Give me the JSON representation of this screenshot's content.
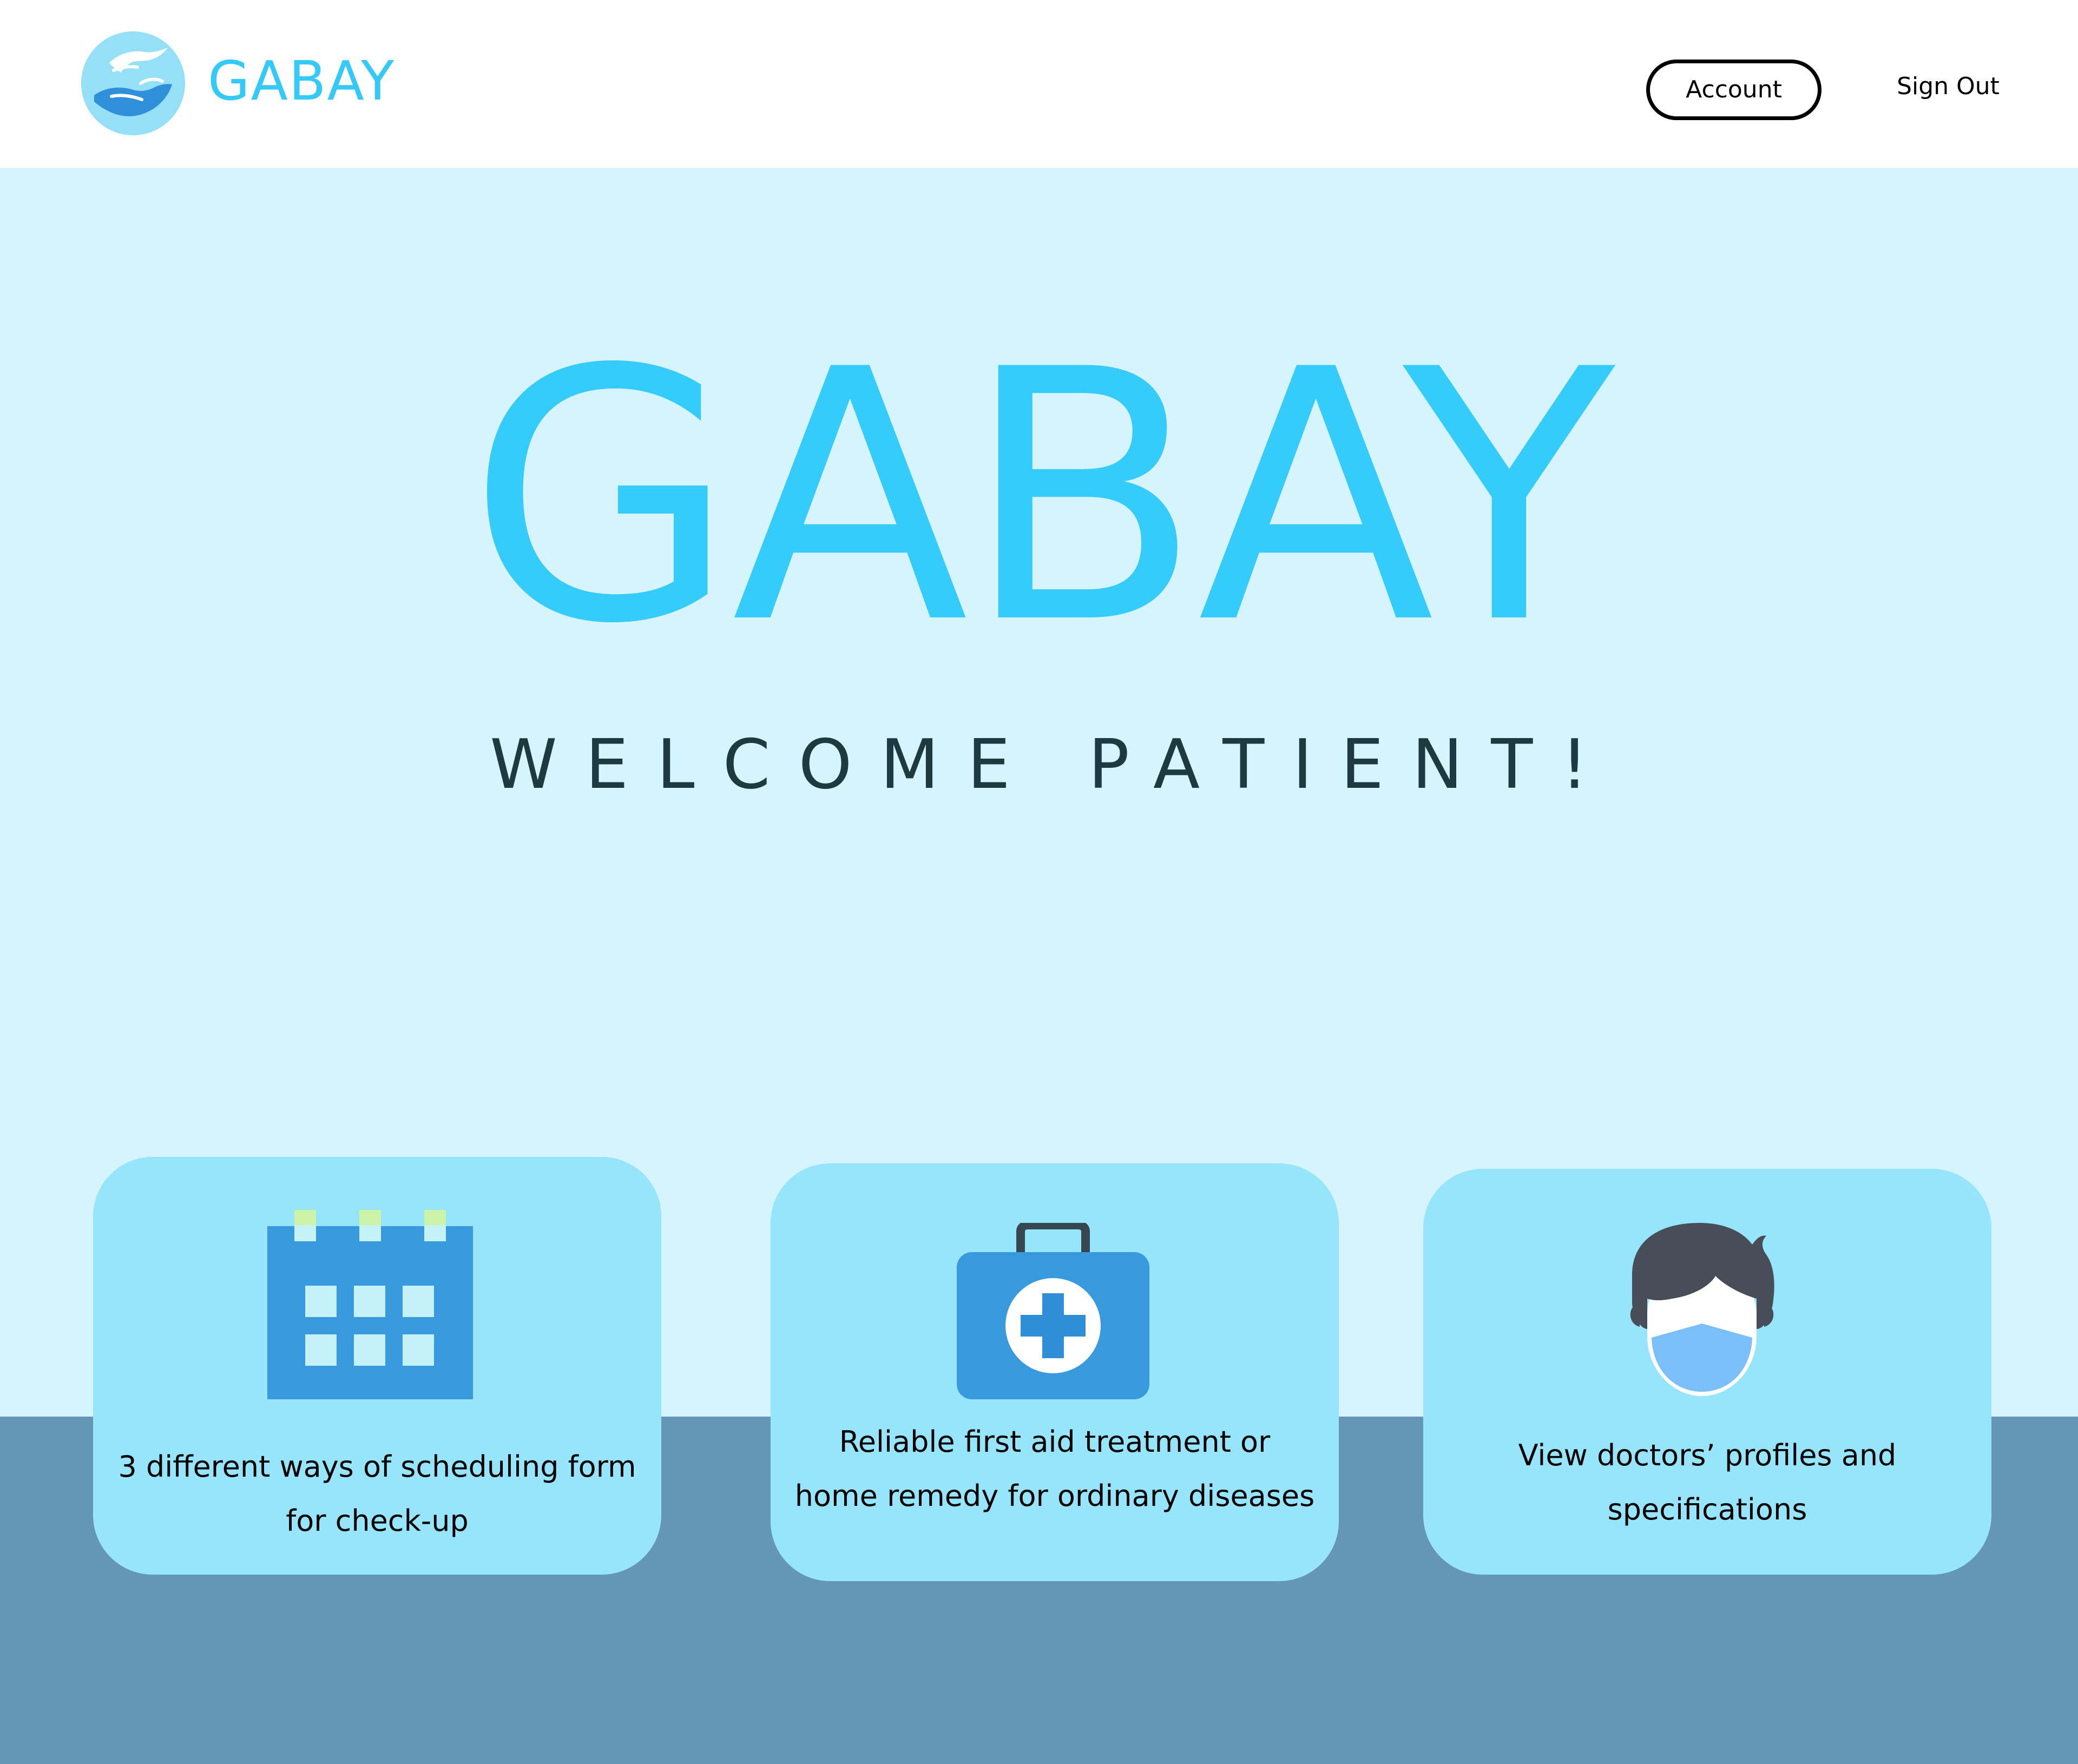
{
  "app": {
    "brand_name": "GABAY",
    "logo_icon": "hands-care-icon",
    "brand_color": "#35cbfa"
  },
  "header": {
    "account_label": "Account",
    "signout_label": "Sign Out"
  },
  "hero": {
    "title": "GABAY",
    "subtitle": "WELCOME PATIENT!"
  },
  "features": [
    {
      "icon": "calendar-icon",
      "line1": "3 different ways of scheduling form",
      "line2": "for check-up"
    },
    {
      "icon": "first-aid-kit-icon",
      "line1": "Reliable first aid treatment or",
      "line2": "home remedy for ordinary diseases"
    },
    {
      "icon": "masked-doctor-icon",
      "line1": "View doctors’ profiles and",
      "line2": "specifications"
    }
  ],
  "colors": {
    "page_background": "#d6f4fd",
    "card_background": "#96e5fc",
    "bottom_band": "#6596b8",
    "icon_blue": "#3899dd"
  }
}
